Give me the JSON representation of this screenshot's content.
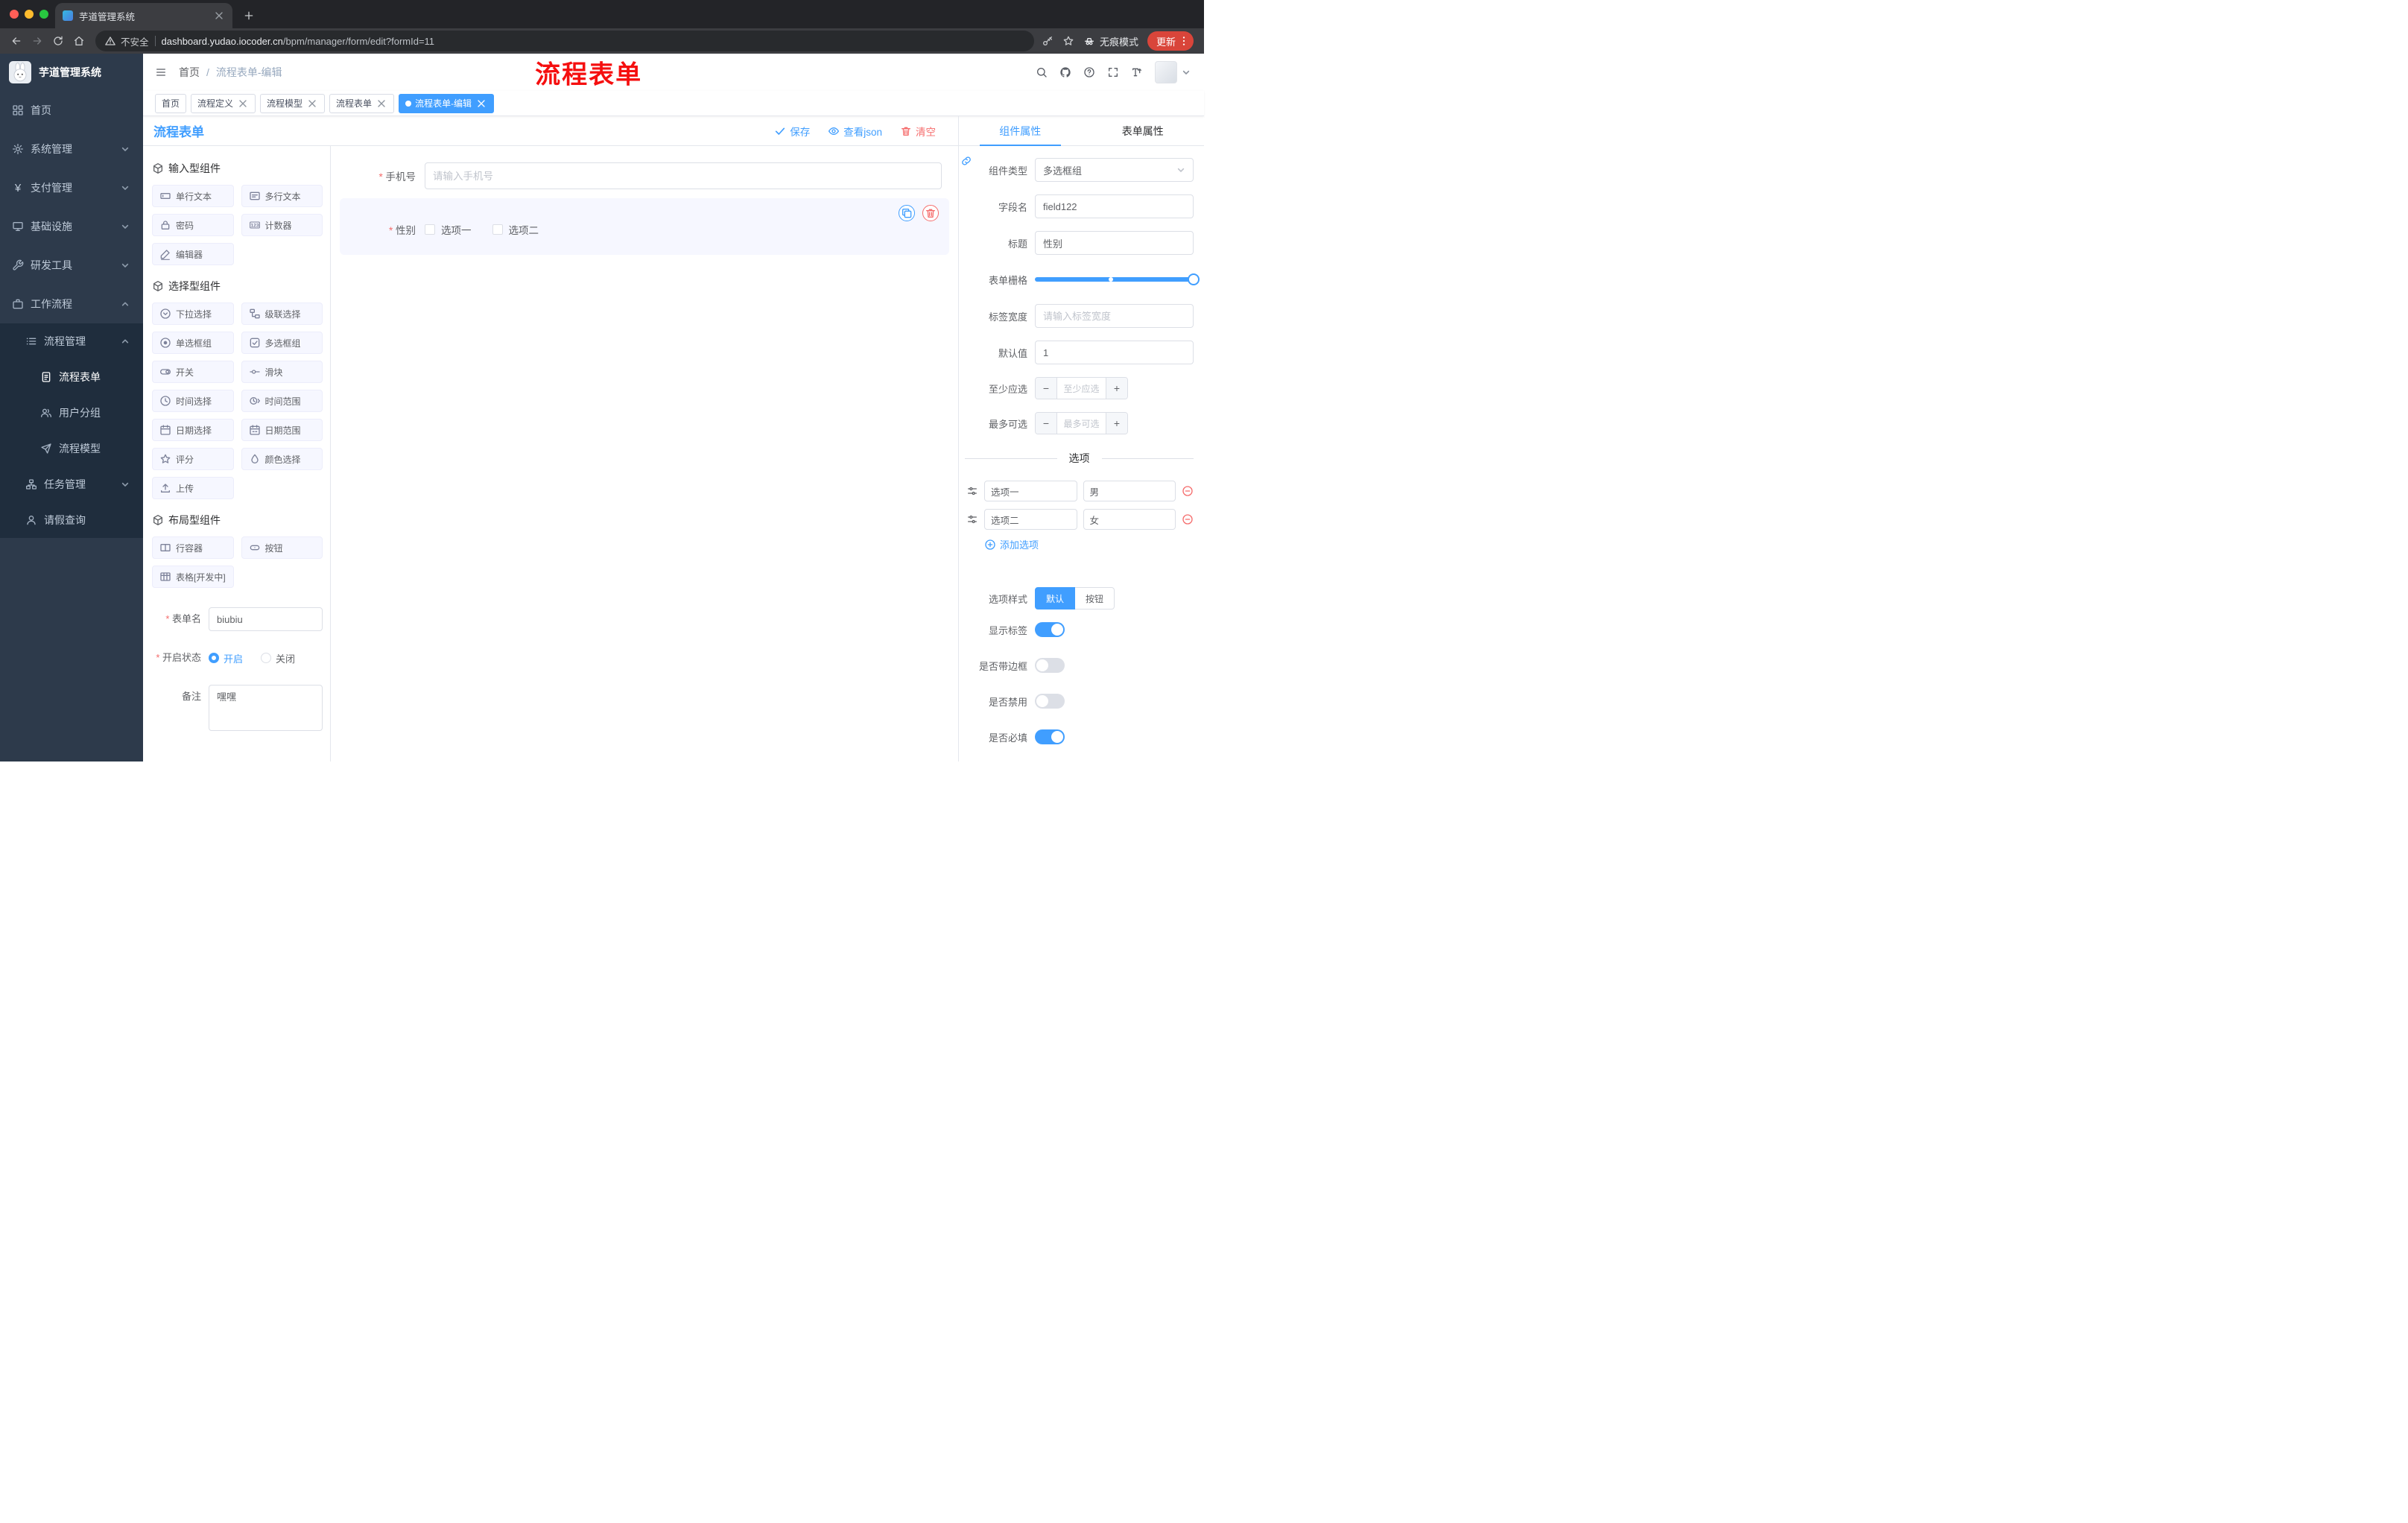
{
  "colors": {
    "accent": "#409eff",
    "danger": "#f56c6c",
    "annotation": "#f50f0f",
    "sidebar_bg": "#2d3a4b",
    "tag_active_bg": "#409eff"
  },
  "browser": {
    "tab_title": "芋道管理系统",
    "security_label": "不安全",
    "url_host": "dashboard.yudao.iocoder.cn",
    "url_path": "/bpm/manager/form/edit?formId=11",
    "incognito_label": "无痕模式",
    "update_label": "更新"
  },
  "sidebar": {
    "logo_title": "芋道管理系统",
    "items": [
      {
        "label": "首页"
      },
      {
        "label": "系统管理"
      },
      {
        "label": "支付管理"
      },
      {
        "label": "基础设施"
      },
      {
        "label": "研发工具"
      },
      {
        "label": "工作流程",
        "expanded": true
      },
      {
        "label": "流程管理",
        "expanded": true
      },
      {
        "label": "流程表单",
        "active": true
      },
      {
        "label": "用户分组"
      },
      {
        "label": "流程模型"
      },
      {
        "label": "任务管理"
      },
      {
        "label": "请假查询"
      }
    ]
  },
  "navbar": {
    "breadcrumb_home": "首页",
    "breadcrumb_sep": "/",
    "breadcrumb_current": "流程表单-编辑",
    "annotation": "流程表单"
  },
  "tags": [
    {
      "label": "首页",
      "closable": false,
      "active": false
    },
    {
      "label": "流程定义",
      "closable": true,
      "active": false
    },
    {
      "label": "流程模型",
      "closable": true,
      "active": false
    },
    {
      "label": "流程表单",
      "closable": true,
      "active": false
    },
    {
      "label": "流程表单-编辑",
      "closable": true,
      "active": true
    }
  ],
  "designer": {
    "title": "流程表单",
    "actions": {
      "save": "保存",
      "view_json": "查看json",
      "clear": "清空"
    },
    "palette": {
      "sections": [
        {
          "title": "输入型组件",
          "items": [
            {
              "label": "单行文本"
            },
            {
              "label": "多行文本"
            },
            {
              "label": "密码"
            },
            {
              "label": "计数器"
            },
            {
              "label": "编辑器"
            }
          ]
        },
        {
          "title": "选择型组件",
          "items": [
            {
              "label": "下拉选择"
            },
            {
              "label": "级联选择"
            },
            {
              "label": "单选框组"
            },
            {
              "label": "多选框组"
            },
            {
              "label": "开关"
            },
            {
              "label": "滑块"
            },
            {
              "label": "时间选择"
            },
            {
              "label": "时间范围"
            },
            {
              "label": "日期选择"
            },
            {
              "label": "日期范围"
            },
            {
              "label": "评分"
            },
            {
              "label": "颜色选择"
            },
            {
              "label": "上传"
            }
          ]
        },
        {
          "title": "布局型组件",
          "items": [
            {
              "label": "行容器"
            },
            {
              "label": "按钮"
            },
            {
              "label": "表格[开发中]"
            }
          ]
        }
      ]
    },
    "meta": {
      "form_name_label": "表单名",
      "form_name_value": "biubiu",
      "status_label": "开启状态",
      "status_on": "开启",
      "status_off": "关闭",
      "status_value": "开启",
      "remark_label": "备注",
      "remark_value": "嘿嘿"
    },
    "canvas": {
      "phone": {
        "label": "手机号",
        "required": true,
        "placeholder": "请输入手机号"
      },
      "gender": {
        "label": "性别",
        "required": true,
        "option1": "选项一",
        "option2": "选项二",
        "selected": true
      }
    }
  },
  "props": {
    "tabs": {
      "component": "组件属性",
      "form": "表单属性",
      "active": "组件属性"
    },
    "component_type_label": "组件类型",
    "component_type_value": "多选框组",
    "field_name_label": "字段名",
    "field_name_value": "field122",
    "title_label": "标题",
    "title_value": "性别",
    "grid_label": "表单栅格",
    "label_width_label": "标签宽度",
    "label_width_placeholder": "请输入标签宽度",
    "default_label": "默认值",
    "default_value": "1",
    "min_label": "至少应选",
    "min_placeholder": "至少应选",
    "max_label": "最多可选",
    "max_placeholder": "最多可选",
    "options_title": "选项",
    "options": [
      {
        "label": "选项一",
        "value": "男"
      },
      {
        "label": "选项二",
        "value": "女"
      }
    ],
    "add_option_label": "添加选项",
    "option_style_label": "选项样式",
    "option_style_default": "默认",
    "option_style_button": "按钮",
    "option_style_selected": "默认",
    "toggles": [
      {
        "label": "显示标签",
        "on": true
      },
      {
        "label": "是否带边框",
        "on": false
      },
      {
        "label": "是否禁用",
        "on": false
      },
      {
        "label": "是否必填",
        "on": true
      }
    ]
  }
}
